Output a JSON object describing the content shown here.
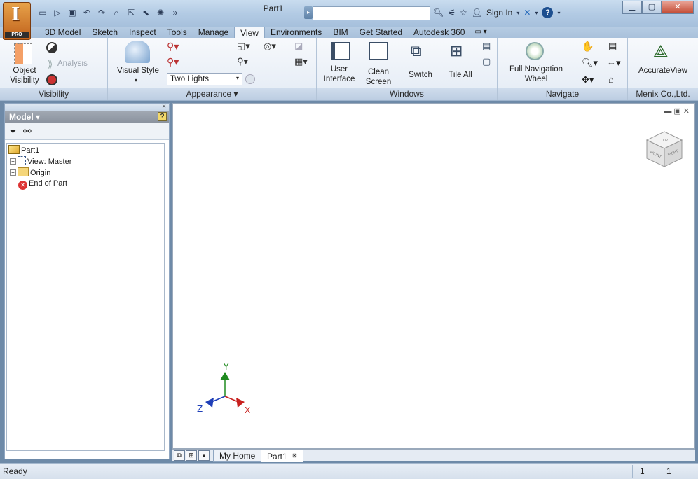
{
  "window": {
    "title": "Part1",
    "signin_label": "Sign In",
    "help_label": "?"
  },
  "app_button": {
    "logo": "I",
    "badge": "PRO"
  },
  "tabs": [
    "3D Model",
    "Sketch",
    "Inspect",
    "Tools",
    "Manage",
    "View",
    "Environments",
    "BIM",
    "Get Started",
    "Autodesk 360"
  ],
  "active_tab": "View",
  "panels": {
    "visibility": {
      "label": "Visibility",
      "object_visibility": "Object Visibility",
      "analysis": "Analysis"
    },
    "appearance": {
      "label": "Appearance ▾",
      "visual_style": "Visual Style",
      "lighting_value": "Two Lights"
    },
    "windows": {
      "label": "Windows",
      "user_interface": "User Interface",
      "clean_screen": "Clean Screen",
      "switch": "Switch",
      "tile_all": "Tile All"
    },
    "navigate": {
      "label": "Navigate",
      "full_nav_wheel": "Full Navigation Wheel"
    },
    "menix": {
      "label": "Menix Co.,Ltd.",
      "accurate_view": "AccurateView"
    }
  },
  "browser": {
    "title": "Model ▾",
    "close": "×",
    "help": "?",
    "tree": [
      {
        "label": "Part1"
      },
      {
        "label": "View: Master"
      },
      {
        "label": "Origin"
      },
      {
        "label": "End of Part"
      }
    ]
  },
  "viewcube": {
    "top": "TOP",
    "front": "FRONT",
    "right": "RIGHT"
  },
  "triad": {
    "x": "X",
    "y": "Y",
    "z": "Z"
  },
  "doc_tabs": {
    "home": "My Home",
    "part": "Part1"
  },
  "status": {
    "text": "Ready",
    "cell1": "1",
    "cell2": "1"
  },
  "colors": {
    "x_axis": "#c8201e",
    "y_axis": "#1f8a1f",
    "z_axis": "#1f3fb8"
  }
}
